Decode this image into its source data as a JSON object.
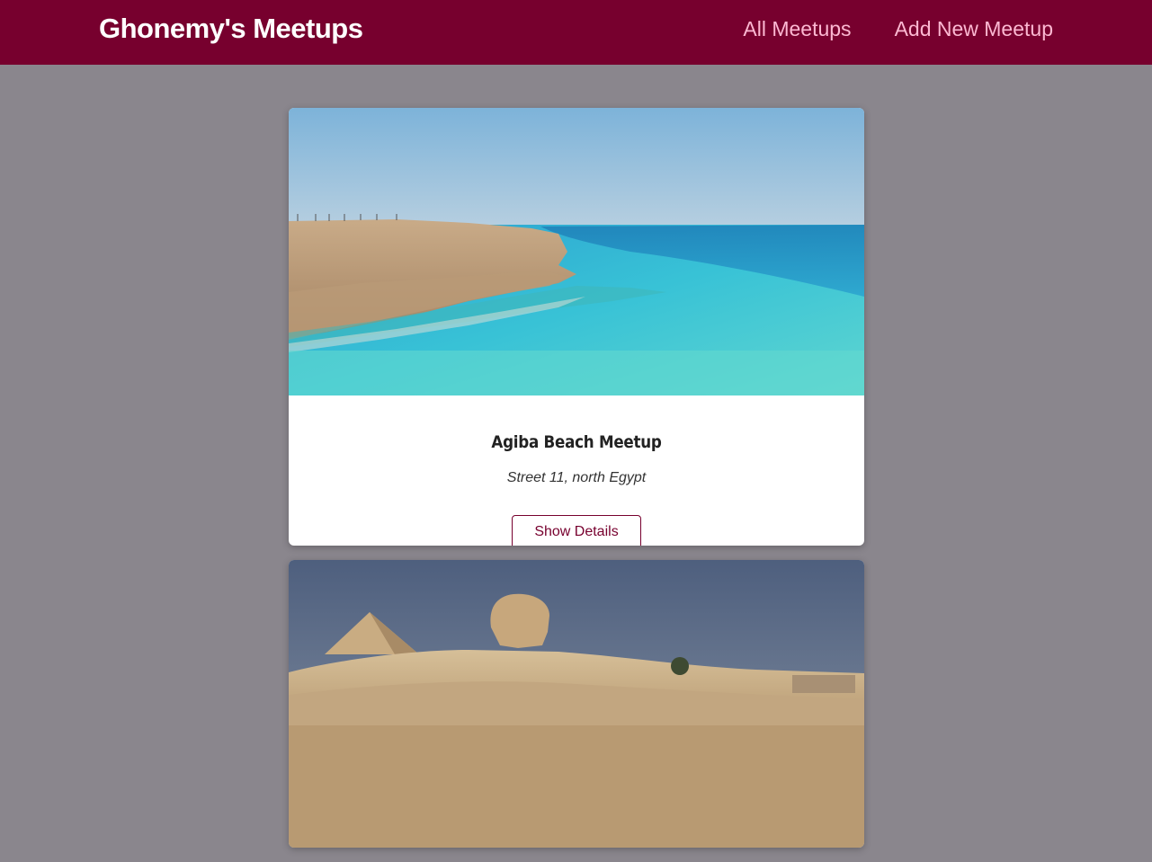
{
  "header": {
    "logo": "Ghonemy's Meetups",
    "nav": [
      {
        "label": "All Meetups"
      },
      {
        "label": "Add New Meetup"
      }
    ]
  },
  "meetups": [
    {
      "title": "Agiba Beach Meetup",
      "address": "Street 11, north Egypt",
      "button_label": "Show Details"
    },
    {
      "title": "",
      "address": "",
      "button_label": ""
    }
  ],
  "colors": {
    "header_bg": "#77002e",
    "nav_link": "#fcb8d2",
    "page_bg": "#8a868d",
    "button_border": "#77002e"
  }
}
